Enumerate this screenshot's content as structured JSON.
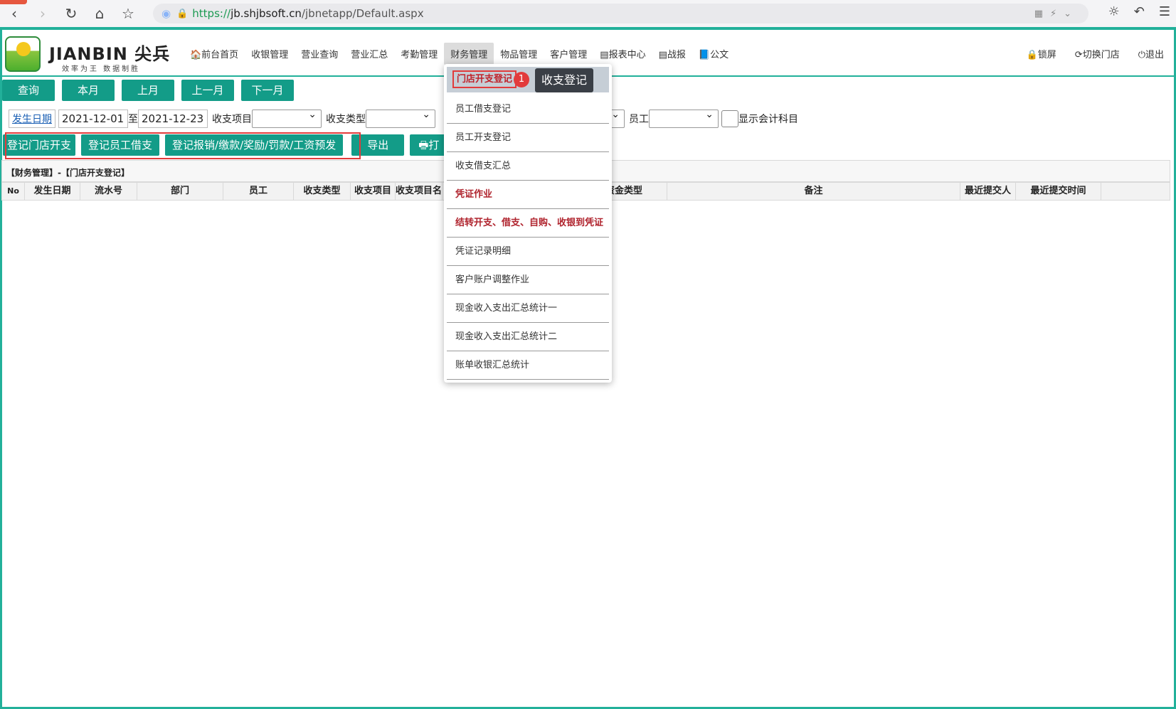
{
  "browser": {
    "url_scheme": "https://",
    "url_host": "jb.shjbsoft.cn",
    "url_path": "/jbnetapp/Default.aspx"
  },
  "brand": {
    "name": "JIANBIN 尖兵",
    "slogan": "效率为王  数据制胜"
  },
  "menu": {
    "items": [
      "🏠前台首页",
      "收银管理",
      "营业查询",
      "营业汇总",
      "考勤管理",
      "财务管理",
      "物品管理",
      "客户管理",
      "▤报表中心",
      "▤战报",
      "📘公文"
    ],
    "right": [
      "🔒锁屏",
      "⟳切换门店",
      "⏻退出"
    ]
  },
  "toolbar": {
    "row1": [
      "查询",
      "本月",
      "上月",
      "上一月",
      "下一月"
    ],
    "row2": [
      "登记门店开支",
      "登记员工借支",
      "登记报销/缴款/奖励/罚款/工资预发",
      "导出",
      "🖶打"
    ]
  },
  "filter": {
    "date_label": "发生日期",
    "date_from": "2021-12-01",
    "to": "至",
    "date_to": "2021-12-23",
    "item_label": "收支项目",
    "type_label": "收支类型",
    "staff_label": "员工",
    "show_account_label": "显示会计科目"
  },
  "grid": {
    "title": "【财务管理】-【门店开支登记】",
    "columns": [
      "No",
      "发生日期",
      "流水号",
      "部门",
      "员工",
      "收支类型",
      "收支项目",
      "收支项目名",
      "",
      "资金类型",
      "备注",
      "最近提交人",
      "最近提交时间",
      ""
    ]
  },
  "dropdown": {
    "items": [
      "门店开支登记",
      "员工借支登记",
      "员工开支登记",
      "收支借支汇总",
      "凭证作业",
      "结转开支、借支、自购、收银到凭证",
      "凭证记录明细",
      "客户账户调整作业",
      "现金收入支出汇总统计一",
      "现金收入支出汇总统计二",
      "账单收银汇总统计"
    ]
  },
  "annotation": {
    "step": "1",
    "tip": "收支登记"
  }
}
